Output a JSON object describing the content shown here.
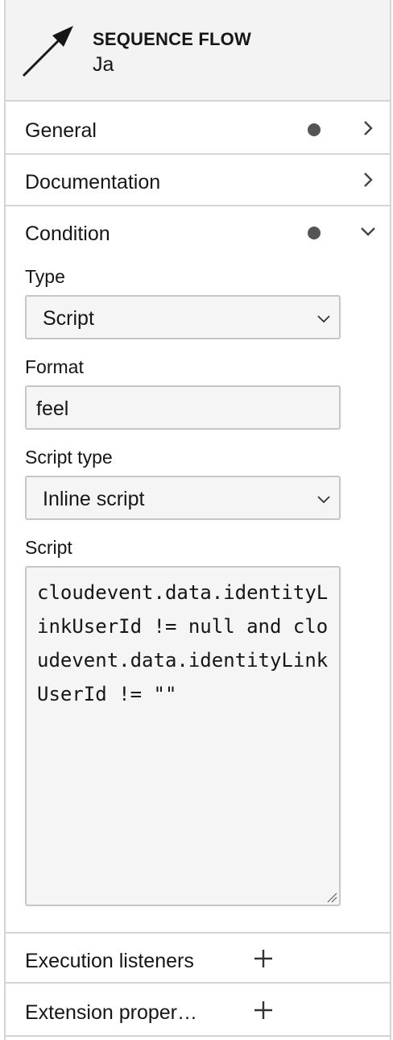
{
  "header": {
    "type_label": "SEQUENCE FLOW",
    "element_name": "Ja",
    "icon": "sequence-flow-arrow-icon"
  },
  "groups": {
    "general": {
      "title": "General",
      "has_entries": true,
      "expanded": false,
      "icon": "chevron-right-icon"
    },
    "documentation": {
      "title": "Documentation",
      "has_entries": false,
      "expanded": false,
      "icon": "chevron-right-icon"
    },
    "condition": {
      "title": "Condition",
      "has_entries": true,
      "expanded": true,
      "icon": "chevron-down-icon"
    },
    "execution_listeners": {
      "title": "Execution listeners",
      "icon": "plus-icon"
    },
    "extension_properties": {
      "title": "Extension proper…",
      "icon": "plus-icon"
    }
  },
  "condition": {
    "type": {
      "label": "Type",
      "value": "Script"
    },
    "format": {
      "label": "Format",
      "value": "feel"
    },
    "script_type": {
      "label": "Script type",
      "value": "Inline script"
    },
    "script": {
      "label": "Script",
      "value": "cloudevent.data.identityLinkUserId != null and cloudevent.data.identityLinkUserId != \"\""
    }
  },
  "colors": {
    "header_bg": "#f3f3f3",
    "border": "#d4d4d4",
    "field_bg": "#f5f5f5",
    "dot": "#555555",
    "text": "#161616"
  }
}
